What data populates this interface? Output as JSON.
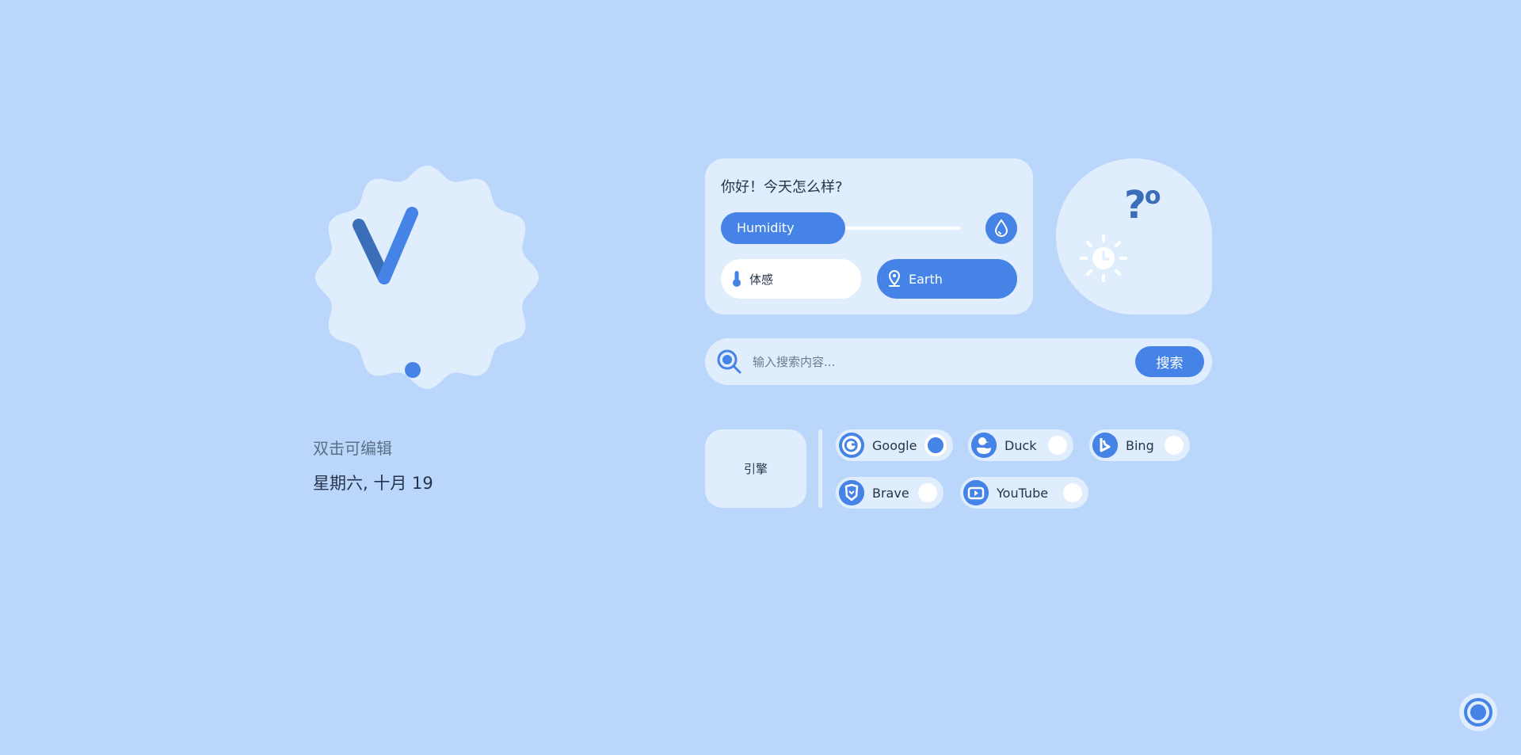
{
  "clock": {
    "greeting_edit": "双击可编辑",
    "date": "星期六, 十月 19"
  },
  "weather": {
    "greeting": "你好！今天怎么样?",
    "humidity_label": "Humidity",
    "feels_label": "体感",
    "location": "Earth",
    "temperature": "?",
    "temperature_unit": "o",
    "humidity_level": 0.5
  },
  "search": {
    "placeholder": "输入搜索内容...",
    "button_label": "搜索"
  },
  "engines": {
    "section_label": "引擎",
    "items": [
      {
        "name": "Google",
        "selected": true
      },
      {
        "name": "Duck",
        "selected": false
      },
      {
        "name": "Bing",
        "selected": false
      },
      {
        "name": "Brave",
        "selected": false
      },
      {
        "name": "YouTube",
        "selected": false
      }
    ]
  },
  "colors": {
    "background": "#bad6fb",
    "card": "#e0edfd",
    "accent": "#4583e7",
    "accent_dark": "#3a6eb9"
  },
  "icons": {
    "clock_hands": "v-clock-hands-icon",
    "humidity": "water-drop-icon",
    "feels": "thermometer-icon",
    "location": "location-pin-icon",
    "weather": "sun-icon",
    "search": "search-icon",
    "settings": "settings-ring-icon"
  }
}
